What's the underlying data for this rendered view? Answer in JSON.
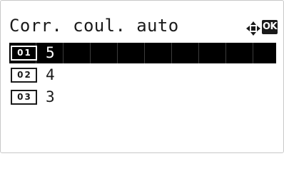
{
  "header": {
    "title": "Corr. coul. auto",
    "nav_icon": "four-way-arrow-icon",
    "ok_label": "OK"
  },
  "list": {
    "items": [
      {
        "number": "01",
        "label": "5",
        "selected": true
      },
      {
        "number": "02",
        "label": "4",
        "selected": false
      },
      {
        "number": "03",
        "label": "3",
        "selected": false
      }
    ]
  }
}
